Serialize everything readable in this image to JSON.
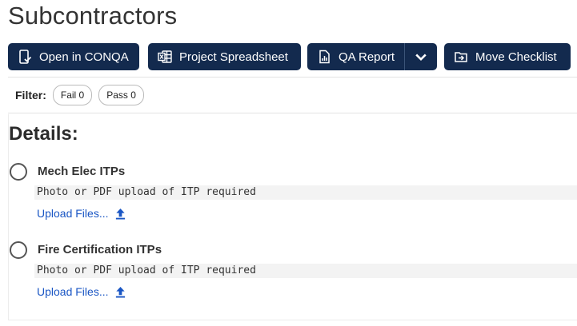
{
  "page": {
    "title": "Subcontractors"
  },
  "toolbar": {
    "open_label": "Open in CONQA",
    "spreadsheet_label": "Project Spreadsheet",
    "qa_label": "QA Report",
    "move_label": "Move Checklist",
    "icons": [
      "device-check-icon",
      "excel-icon",
      "report-icon",
      "chevron-down-icon",
      "move-icon"
    ],
    "button_color": "#132a4e"
  },
  "filter": {
    "label": "Filter:",
    "fail_label": "Fail 0",
    "pass_label": "Pass 0"
  },
  "details": {
    "heading": "Details:",
    "items": [
      {
        "title": "Mech Elec ITPs",
        "note": "Photo or PDF upload of ITP required",
        "upload_label": "Upload Files..."
      },
      {
        "title": "Fire Certification ITPs",
        "note": "Photo or PDF upload of ITP required",
        "upload_label": "Upload Files..."
      }
    ],
    "link_color": "#1a56c4"
  }
}
